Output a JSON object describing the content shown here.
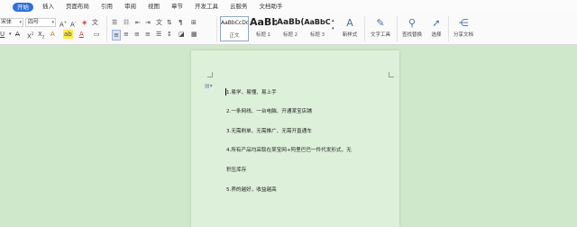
{
  "menu": {
    "items": [
      "开始",
      "插入",
      "页面布局",
      "引用",
      "审阅",
      "视图",
      "章节",
      "开发工具",
      "云服务",
      "文档助手"
    ],
    "active_index": 0
  },
  "ribbon": {
    "font_name": "宋体",
    "font_size": "四号",
    "styles": [
      {
        "preview": "AaBbCcDd",
        "label": "正文"
      },
      {
        "preview": "AaBb",
        "label": "标题 1"
      },
      {
        "preview": "AaBb(",
        "label": "标题 2"
      },
      {
        "preview": "AaBbC",
        "label": "标题 3"
      }
    ],
    "new_style_label": "新样式",
    "text_tools_label": "文字工具",
    "find_replace_label": "查找替换",
    "select_label": "选择",
    "share_label": "分享文档"
  },
  "document": {
    "lines": [
      "1.易学、易懂、易上手",
      "2.一条网线、一台电脑、开通某宝店铺",
      "3.无需刷单、无需推广、无需开直通车",
      "4.所有产品均采取在某宝网+阿里巴巴一件代发形式，无",
      "积压库存",
      "5.养的越好，收益越高"
    ]
  }
}
